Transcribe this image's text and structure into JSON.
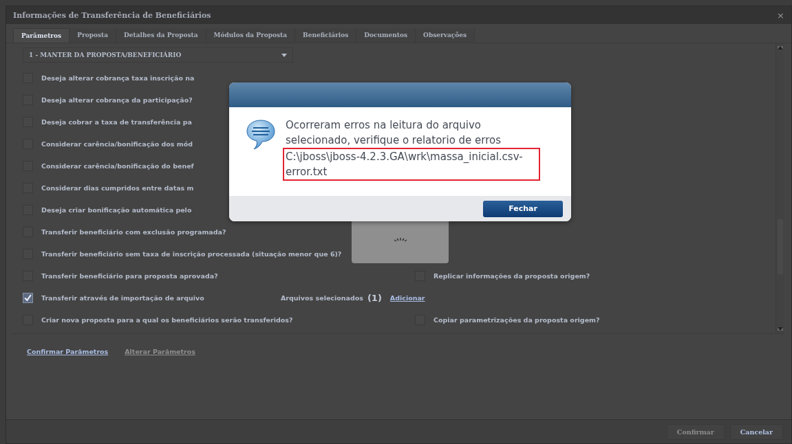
{
  "window": {
    "title": "Informações de Transferência de Beneficiários",
    "close": "×"
  },
  "tabs": [
    {
      "label": "Parâmetros",
      "selected": true
    },
    {
      "label": "Proposta",
      "selected": false
    },
    {
      "label": "Detalhes da Proposta",
      "selected": false
    },
    {
      "label": "Módulos da Proposta",
      "selected": false
    },
    {
      "label": "Beneficiários",
      "selected": false
    },
    {
      "label": "Documentos",
      "selected": false
    },
    {
      "label": "Observações",
      "selected": false
    }
  ],
  "mode_select": {
    "value": "1 - MANTER DA PROPOSTA/BENEFICIÁRIO"
  },
  "options": [
    {
      "label": "Deseja alterar cobrança taxa inscrição na",
      "checked": false
    },
    {
      "label": "Deseja alterar cobrança da participação?",
      "checked": false
    },
    {
      "label": "Deseja cobrar a taxa de transferência pa",
      "checked": false
    },
    {
      "label": "Considerar carência/bonificação dos mód",
      "checked": false
    },
    {
      "label": "Considerar carência/bonificação do benef",
      "checked": false
    },
    {
      "label": "Considerar dias cumpridos entre datas m",
      "checked": false
    },
    {
      "label": "Deseja criar bonificação automática pelo",
      "checked": false
    },
    {
      "label": "Transferir beneficiário com exclusão programada?",
      "checked": false
    },
    {
      "label": "Transferir beneficiário sem taxa de inscrição processada (situação menor que 6)?",
      "checked": false
    },
    {
      "label": "Transferir beneficiário para proposta aprovada?",
      "checked": false,
      "side": {
        "label": "Replicar informações da proposta origem?",
        "checked": false
      }
    },
    {
      "label": "Transferir através de importação de arquivo",
      "checked": true,
      "files": {
        "label": "Arquivos selecionados",
        "count": "(1)",
        "link": "Adicionar"
      }
    },
    {
      "label": "Criar nova proposta para a qual os beneficiários serão transferidos?",
      "checked": false,
      "side": {
        "label": "Copiar parametrizações da proposta origem?",
        "checked": false
      }
    }
  ],
  "actions": [
    {
      "label": "Confirmar Parâmetros",
      "disabled": false
    },
    {
      "label": "Alterar Parâmetros",
      "disabled": true
    }
  ],
  "footer_buttons": [
    {
      "label": "Confirmar",
      "disabled": true
    },
    {
      "label": "Cancelar",
      "disabled": false
    }
  ],
  "dialog": {
    "message": "Ocorreram erros na leitura do arquivo selecionado, verifique o relatorio de erros",
    "path": "C:\\jboss\\jboss-4.2.3.GA\\wrk\\massa_inicial.csv-error.txt",
    "button": "Fechar"
  }
}
